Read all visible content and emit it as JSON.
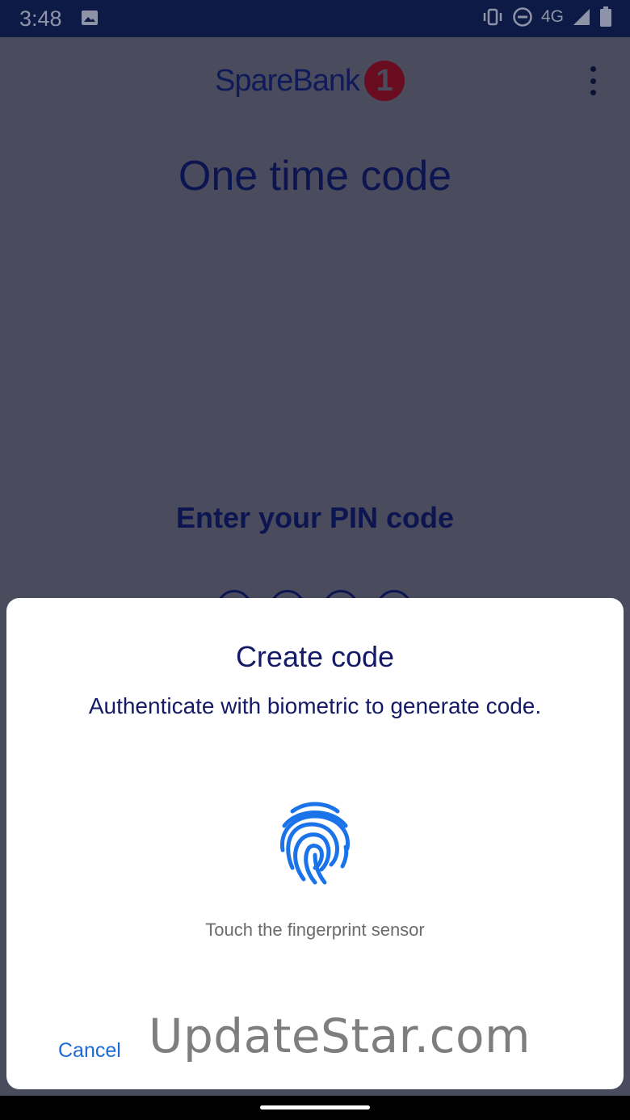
{
  "status_bar": {
    "time": "3:48",
    "network": "4G",
    "icons": [
      "image-icon",
      "vibrate-icon",
      "do-not-disturb-icon",
      "signal-icon",
      "battery-icon"
    ]
  },
  "header": {
    "logo_text": "SpareBank",
    "logo_badge": "1",
    "menu_icon": "more-vert-icon"
  },
  "main": {
    "title": "One time code",
    "pin_prompt": "Enter your PIN code"
  },
  "dialog": {
    "title": "Create code",
    "description": "Authenticate with biometric to generate code.",
    "icon": "fingerprint-icon",
    "hint": "Touch the fingerprint sensor",
    "cancel_label": "Cancel"
  },
  "watermark": "UpdateStar.com",
  "colors": {
    "brand_navy": "#0c1550",
    "brand_red": "#6a0c1f",
    "accent_blue": "#1a6bd4",
    "scrim": "#4a4b5d"
  }
}
